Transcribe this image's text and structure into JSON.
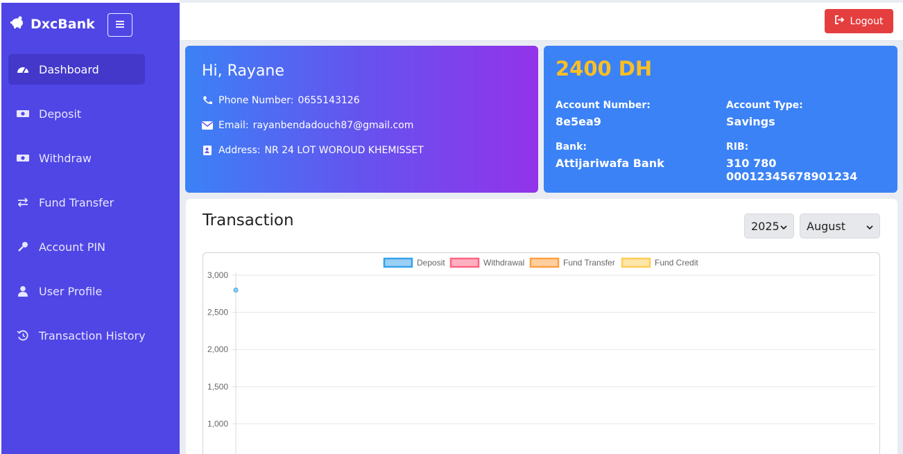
{
  "brand": {
    "name": "DxcBank",
    "icon": "piggy-bank-icon"
  },
  "sidebar": {
    "items": [
      {
        "label": "Dashboard",
        "icon": "tachometer-icon",
        "active": true
      },
      {
        "label": "Deposit",
        "icon": "money-bill-icon"
      },
      {
        "label": "Withdraw",
        "icon": "money-bill-icon"
      },
      {
        "label": "Fund Transfer",
        "icon": "exchange-arrows-icon"
      },
      {
        "label": "Account PIN",
        "icon": "key-icon"
      },
      {
        "label": "User Profile",
        "icon": "user-icon"
      },
      {
        "label": "Transaction History",
        "icon": "history-icon"
      }
    ]
  },
  "header": {
    "logout_label": "Logout"
  },
  "profile": {
    "greeting": "Hi, Rayane",
    "phone_label": "Phone Number:",
    "phone": "0655143126",
    "email_label": "Email:",
    "email": "rayanbendadouch87@gmail.com",
    "address_label": "Address:",
    "address": "NR 24 LOT WOROUD KHEMISSET"
  },
  "account": {
    "balance": "2400 DH",
    "number_label": "Account Number:",
    "number": "8e5ea9",
    "type_label": "Account Type:",
    "type": "Savings",
    "bank_label": "Bank:",
    "bank": "Attijariwafa Bank",
    "rib_label": "RIB:",
    "rib": "310 780 00012345678901234"
  },
  "transactions": {
    "title": "Transaction",
    "year": "2025",
    "month": "August"
  },
  "colors": {
    "sidebar": "#4f46e5",
    "accent_blue": "#3b82f6",
    "balance": "#fbbf24",
    "logout": "#e53e3e"
  },
  "chart_data": {
    "type": "line",
    "series": [
      {
        "name": "Deposit",
        "color": "#36a2eb",
        "values": [
          2800
        ]
      },
      {
        "name": "Withdrawal",
        "color": "#ff6384",
        "values": []
      },
      {
        "name": "Fund Transfer",
        "color": "#ff9f40",
        "values": []
      },
      {
        "name": "Fund Credit",
        "color": "#ffcd56",
        "values": []
      }
    ],
    "yticks": [
      "3,000",
      "2,500",
      "2,000",
      "1,500",
      "1,000"
    ],
    "ylim": [
      1000,
      3000
    ],
    "grid": true,
    "legend": "top"
  }
}
